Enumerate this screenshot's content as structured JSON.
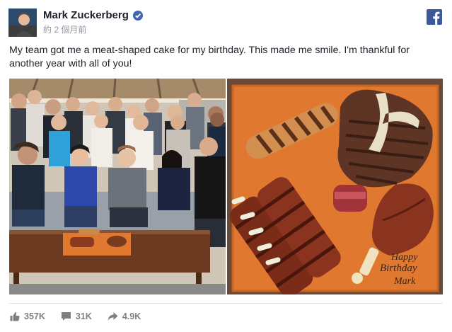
{
  "post": {
    "author": "Mark Zuckerberg",
    "time": "約 2 個月前",
    "text": "My team got me a meat-shaped cake for my birthday. This made me smile. I'm thankful for another year with all of you!"
  },
  "cake_text": {
    "line1": "Happy",
    "line2": "Birthday",
    "line3": "Mark"
  },
  "stats": {
    "likes": "357K",
    "comments": "31K",
    "shares": "4.9K"
  },
  "colors": {
    "facebook_blue": "#3b5998",
    "verified_blue": "#4267b2",
    "cake_orange": "#e0792f",
    "muted_text": "#7f7f7f"
  },
  "icons": [
    "verified-badge-icon",
    "facebook-logo-icon",
    "like-icon",
    "comment-icon",
    "share-icon"
  ]
}
